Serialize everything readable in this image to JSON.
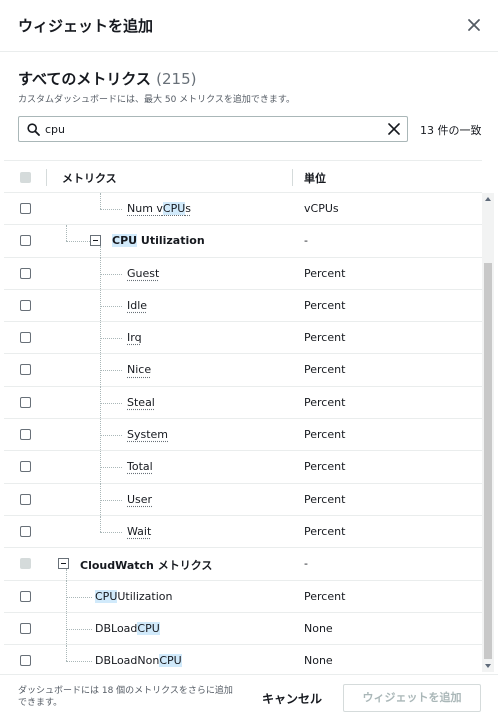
{
  "dialog": {
    "title": "ウィジェットを追加"
  },
  "section": {
    "title": "すべてのメトリクス",
    "count": "(215)",
    "description": "カスタムダッシュボードには、最大 50 メトリクスを追加できます。"
  },
  "search": {
    "value": "cpu",
    "match_count": "13 件の一致"
  },
  "table": {
    "headers": {
      "metric": "メトリクス",
      "unit": "単位"
    },
    "rows": [
      {
        "name_pre": "Num v",
        "name_hl": "CPU",
        "name_post": "s",
        "unit": "vCPUs"
      },
      {
        "name_pre": "",
        "name_hl": "CPU",
        "name_post": " Utilization",
        "unit": "-"
      },
      {
        "name": "Guest",
        "unit": "Percent"
      },
      {
        "name": "Idle",
        "unit": "Percent"
      },
      {
        "name": "Irq",
        "unit": "Percent"
      },
      {
        "name": "Nice",
        "unit": "Percent"
      },
      {
        "name": "Steal",
        "unit": "Percent"
      },
      {
        "name": "System",
        "unit": "Percent"
      },
      {
        "name": "Total",
        "unit": "Percent"
      },
      {
        "name": "User",
        "unit": "Percent"
      },
      {
        "name": "Wait",
        "unit": "Percent"
      },
      {
        "name": "CloudWatch メトリクス",
        "unit": "-"
      },
      {
        "name_pre": "",
        "name_hl": "CPU",
        "name_post": "Utilization",
        "unit": "Percent"
      },
      {
        "name_pre": "DBLoad",
        "name_hl": "CPU",
        "name_post": "",
        "unit": "None"
      },
      {
        "name_pre": "DBLoadNon",
        "name_hl": "CPU",
        "name_post": "",
        "unit": "None"
      }
    ]
  },
  "footer": {
    "note": "ダッシュボードには 18 個のメトリクスをさらに追加できます。",
    "cancel_label": "キャンセル",
    "add_label": "ウィジェットを追加"
  },
  "icons": {
    "close": "close-icon",
    "search": "search-icon",
    "clear": "clear-icon",
    "collapse": "minus-square-icon"
  },
  "colors": {
    "highlight": "#d1eafb",
    "text": "#16191f",
    "muted": "#545b64"
  }
}
